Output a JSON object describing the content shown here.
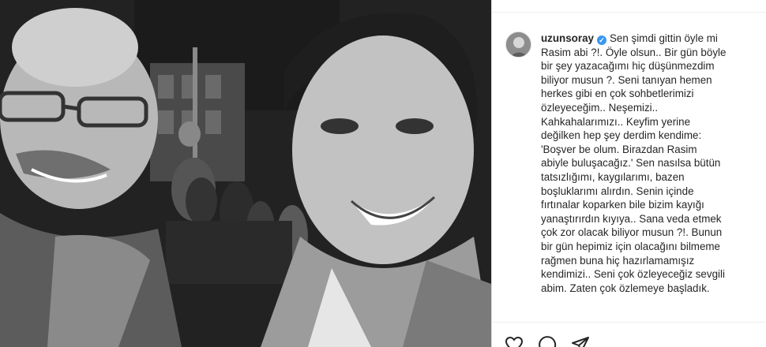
{
  "post": {
    "username": "uzunsoray",
    "verified_icon": "verified-badge-icon",
    "caption_lines": [
      "Sen şimdi gittin öyle mi",
      "Rasim abi ?!. Öyle olsun.. Bir gün böyle",
      "bir şey yazacağımı hiç düşünmezdim",
      "biliyor musun ?. Seni tanıyan hemen",
      "herkes gibi en çok sohbetlerimizi",
      "özleyeceğim.. Neşemizi..",
      "Kahkahalarımızı.. Keyfim yerine",
      "değilken hep şey derdim kendime:",
      "'Boşver be olum. Birazdan Rasim",
      "abiyle buluşacağız.' Sen nasılsa bütün",
      "tatsızlığımı, kaygılarımı, bazen",
      "boşluklarımı alırdın. Senin içinde",
      "fırtınalar koparken bile bizim kayığı",
      "yanaştırırdın kıyıya.. Sana veda etmek",
      "çok zor olacak biliyor musun ?!. Bunun",
      "bir gün hepimiz için olacağını bilmeme",
      "rağmen buna hiç hazırlamamışız",
      "kendimizi.. Seni çok özleyeceğiz sevgili",
      "abim. Zaten çok özlemeye başladık."
    ]
  },
  "actions": {
    "like_icon": "heart-icon",
    "comment_icon": "comment-icon",
    "share_icon": "share-icon"
  },
  "colors": {
    "verified": "#3897f0",
    "text": "#262626",
    "border": "#dbdbdb"
  }
}
